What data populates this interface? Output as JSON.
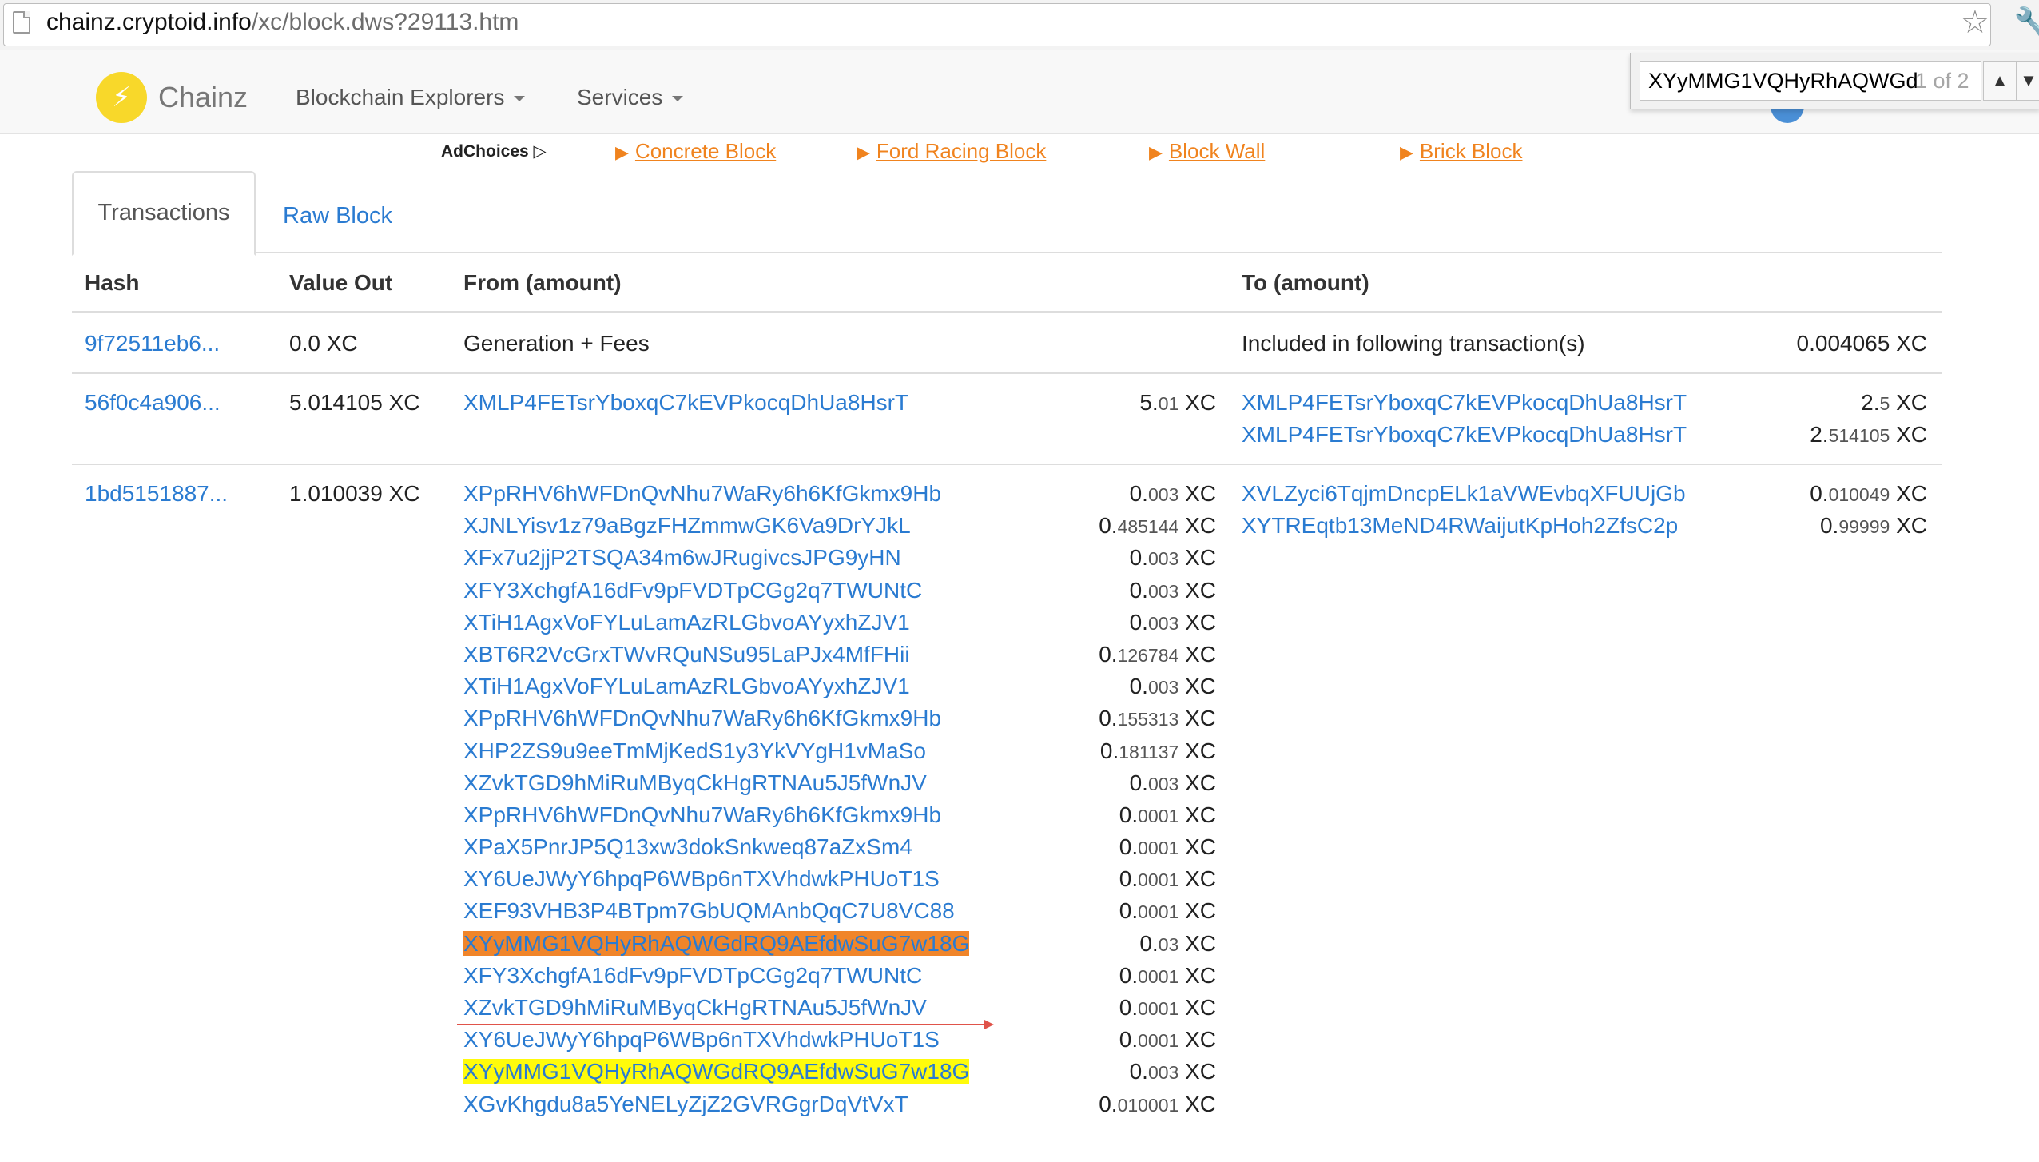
{
  "browser": {
    "url_host": "chainz.cryptoid.info",
    "url_path": "/xc/block.dws?29113.htm",
    "star_icon": "star-icon",
    "wrench_icon": "wrench-icon"
  },
  "find_bar": {
    "query": "XYyMMG1VQHyRhAQWGd",
    "count": "1 of 2",
    "prev": "▲",
    "next": "▼"
  },
  "nav": {
    "brand": "Chainz",
    "logo_glyph": "⚡",
    "explorers": "Blockchain Explorers",
    "services": "Services"
  },
  "ads": {
    "adchoices": "AdChoices ▷",
    "links": [
      "Concrete Block",
      "Ford Racing Block",
      "Block Wall",
      "Brick Block"
    ]
  },
  "tabs": {
    "transactions": "Transactions",
    "raw_block": "Raw Block"
  },
  "table": {
    "headers": {
      "hash": "Hash",
      "value_out": "Value Out",
      "from": "From (amount)",
      "to": "To (amount)"
    },
    "unit": "XC",
    "rows": [
      {
        "hash": "9f72511eb6...",
        "value_int": "0.",
        "value_dec": "0",
        "from_text": "Generation + Fees",
        "to_text": "Included in following transaction(s)",
        "to_amt_int": "0.",
        "to_amt_dec": "004065"
      },
      {
        "hash": "56f0c4a906...",
        "value_int": "5.",
        "value_dec": "014105",
        "from": [
          {
            "addr": "XMLP4FETsrYboxqC7kEVPkocqDhUa8HsrT",
            "int": "5.",
            "dec": "01"
          }
        ],
        "to": [
          {
            "addr": "XMLP4FETsrYboxqC7kEVPkocqDhUa8HsrT",
            "int": "2.",
            "dec": "5"
          },
          {
            "addr": "XMLP4FETsrYboxqC7kEVPkocqDhUa8HsrT",
            "int": "2.",
            "dec": "514105"
          }
        ]
      },
      {
        "hash": "1bd5151887...",
        "value_int": "1.",
        "value_dec": "010039",
        "from": [
          {
            "addr": "XPpRHV6hWFDnQvNhu7WaRy6h6KfGkmx9Hb",
            "int": "0.",
            "dec": "003"
          },
          {
            "addr": "XJNLYisv1z79aBgzFHZmmwGK6Va9DrYJkL",
            "int": "0.",
            "dec": "485144"
          },
          {
            "addr": "XFx7u2jjP2TSQA34m6wJRugivcsJPG9yHN",
            "int": "0.",
            "dec": "003"
          },
          {
            "addr": "XFY3XchgfA16dFv9pFVDTpCGg2q7TWUNtC",
            "int": "0.",
            "dec": "003"
          },
          {
            "addr": "XTiH1AgxVoFYLuLamAzRLGbvoAYyxhZJV1",
            "int": "0.",
            "dec": "003"
          },
          {
            "addr": "XBT6R2VcGrxTWvRQuNSu95LaPJx4MfFHii",
            "int": "0.",
            "dec": "126784"
          },
          {
            "addr": "XTiH1AgxVoFYLuLamAzRLGbvoAYyxhZJV1",
            "int": "0.",
            "dec": "003"
          },
          {
            "addr": "XPpRHV6hWFDnQvNhu7WaRy6h6KfGkmx9Hb",
            "int": "0.",
            "dec": "155313"
          },
          {
            "addr": "XHP2ZS9u9eeTmMjKedS1y3YkVYgH1vMaSo",
            "int": "0.",
            "dec": "181137"
          },
          {
            "addr": "XZvkTGD9hMiRuMByqCkHgRTNAu5J5fWnJV",
            "int": "0.",
            "dec": "003"
          },
          {
            "addr": "XPpRHV6hWFDnQvNhu7WaRy6h6KfGkmx9Hb",
            "int": "0.",
            "dec": "0001"
          },
          {
            "addr": "XPaX5PnrJP5Q13xw3dokSnkweq87aZxSm4",
            "int": "0.",
            "dec": "0001"
          },
          {
            "addr": "XY6UeJWyY6hpqP6WBp6nTXVhdwkPHUoT1S",
            "int": "0.",
            "dec": "0001"
          },
          {
            "addr": "XEF93VHB3P4BTpm7GbUQMAnbQqC7U8VC88",
            "int": "0.",
            "dec": "0001"
          },
          {
            "addr": "XYyMMG1VQHyRhAQWGdRQ9AEfdwSuG7w18G",
            "int": "0.",
            "dec": "03",
            "highlight": "orange"
          },
          {
            "addr": "XFY3XchgfA16dFv9pFVDTpCGg2q7TWUNtC",
            "int": "0.",
            "dec": "0001"
          },
          {
            "addr": "XZvkTGD9hMiRuMByqCkHgRTNAu5J5fWnJV",
            "int": "0.",
            "dec": "0001"
          },
          {
            "addr": "XY6UeJWyY6hpqP6WBp6nTXVhdwkPHUoT1S",
            "int": "0.",
            "dec": "0001"
          },
          {
            "addr": "XYyMMG1VQHyRhAQWGdRQ9AEfdwSuG7w18G",
            "int": "0.",
            "dec": "003",
            "highlight": "yellow"
          },
          {
            "addr": "XGvKhgdu8a5YeNELyZjZ2GVRGgrDqVtVxT",
            "int": "0.",
            "dec": "010001"
          }
        ],
        "to": [
          {
            "addr": "XVLZyci6TqjmDncpELk1aVWEvbqXFUUjGb",
            "int": "0.",
            "dec": "010049"
          },
          {
            "addr": "XYTREqtb13MeND4RWaijutKpHoh2ZfsC2p",
            "int": "0.",
            "dec": "99999"
          }
        ]
      }
    ]
  },
  "colors": {
    "link": "#2a7bd1",
    "ad": "#f0831e",
    "find_highlight_current": "#f0852a",
    "find_highlight_other": "#fffb0b",
    "annotation_arrow": "#e0534a"
  }
}
